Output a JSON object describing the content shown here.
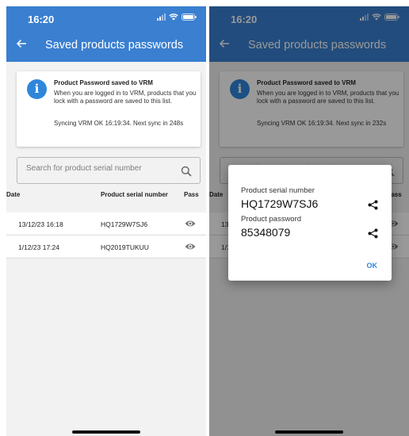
{
  "status": {
    "time": "16:20"
  },
  "appbar": {
    "title": "Saved products passwords"
  },
  "info": {
    "title": "Product Password saved to VRM",
    "body": "When you are logged in to VRM, products that you lock with a password are saved to this list.",
    "sync_left": "Syncing VRM OK 16:19:34. Next sync in 248s",
    "sync_right": "Syncing VRM OK 16:19:34. Next sync in 232s"
  },
  "search": {
    "placeholder": "Search for product serial number"
  },
  "table": {
    "headers": [
      "Date",
      "Product serial number",
      "Pass"
    ],
    "rows": [
      {
        "date": "13/12/23 16:18",
        "serial": "HQ1729W7SJ6"
      },
      {
        "date": "1/12/23 17:24",
        "serial": "HQ2019TUKUU"
      }
    ]
  },
  "dialog": {
    "serial_label": "Product serial number",
    "serial_value": "HQ1729W7SJ6",
    "password_label": "Product password",
    "password_value": "85348079",
    "ok_label": "OK"
  },
  "colors": {
    "appbar": "#3a7fd0",
    "accent": "#2f86db"
  },
  "icons": [
    "back-arrow-icon",
    "info-icon",
    "search-icon",
    "eye-icon",
    "share-icon",
    "signal-icon",
    "wifi-icon",
    "battery-icon"
  ]
}
